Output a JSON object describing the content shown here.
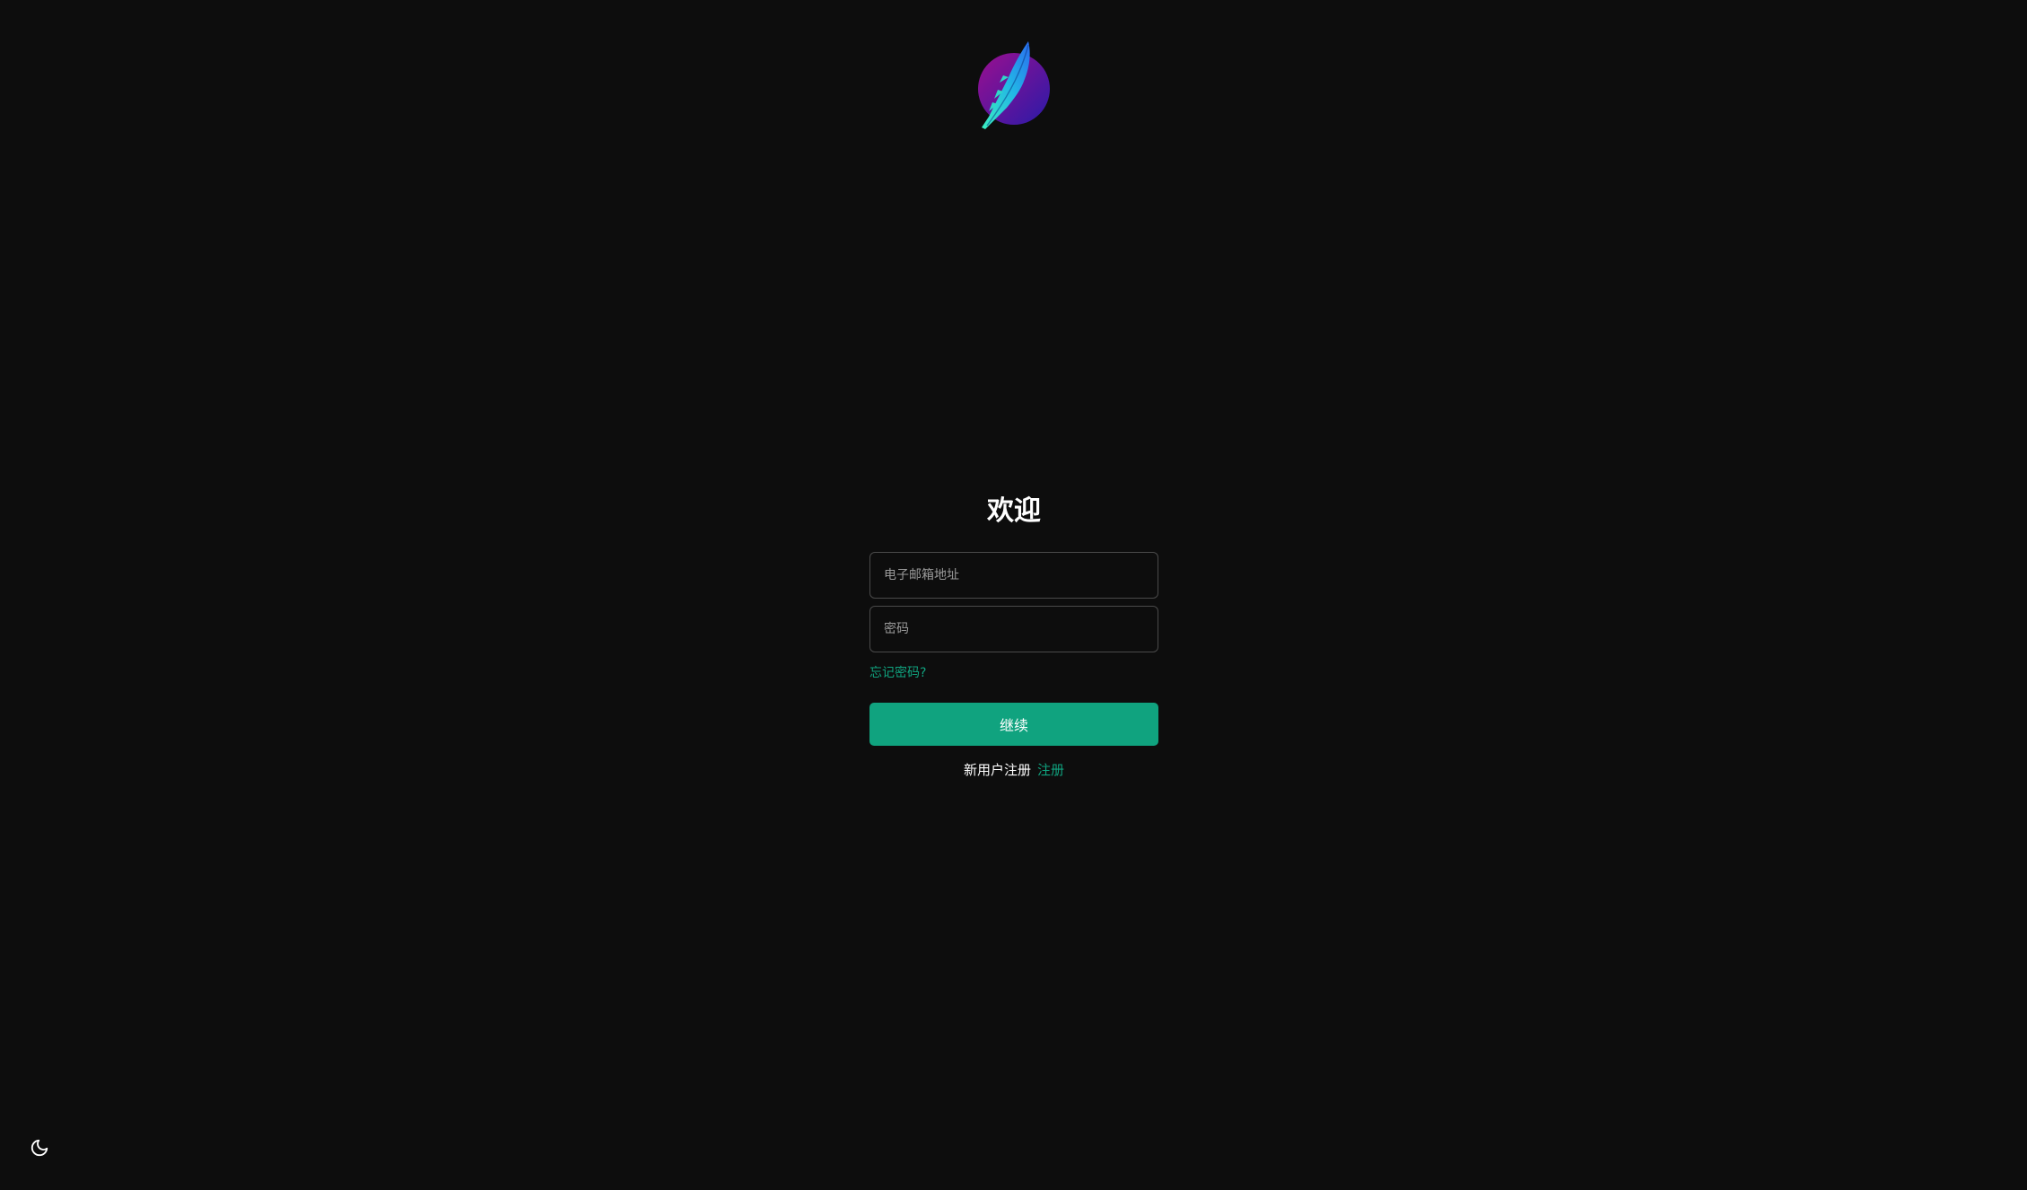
{
  "brand": {
    "logo_icon": "feather-logo-icon",
    "colors": {
      "circle_start": "#9b0f8f",
      "circle_end": "#2a1aa8",
      "feather_start": "#3af0c0",
      "feather_end": "#2a6cf0"
    }
  },
  "login": {
    "title": "欢迎",
    "email_placeholder": "电子邮箱地址",
    "password_placeholder": "密码",
    "forgot_password": "忘记密码?",
    "continue_button": "继续",
    "signup_prompt": "新用户注册",
    "signup_link": "注册"
  },
  "theme_toggle": {
    "icon": "moon-icon"
  },
  "colors": {
    "background": "#0d0d0d",
    "accent": "#10a37f",
    "field_border": "#4a4a4a"
  }
}
